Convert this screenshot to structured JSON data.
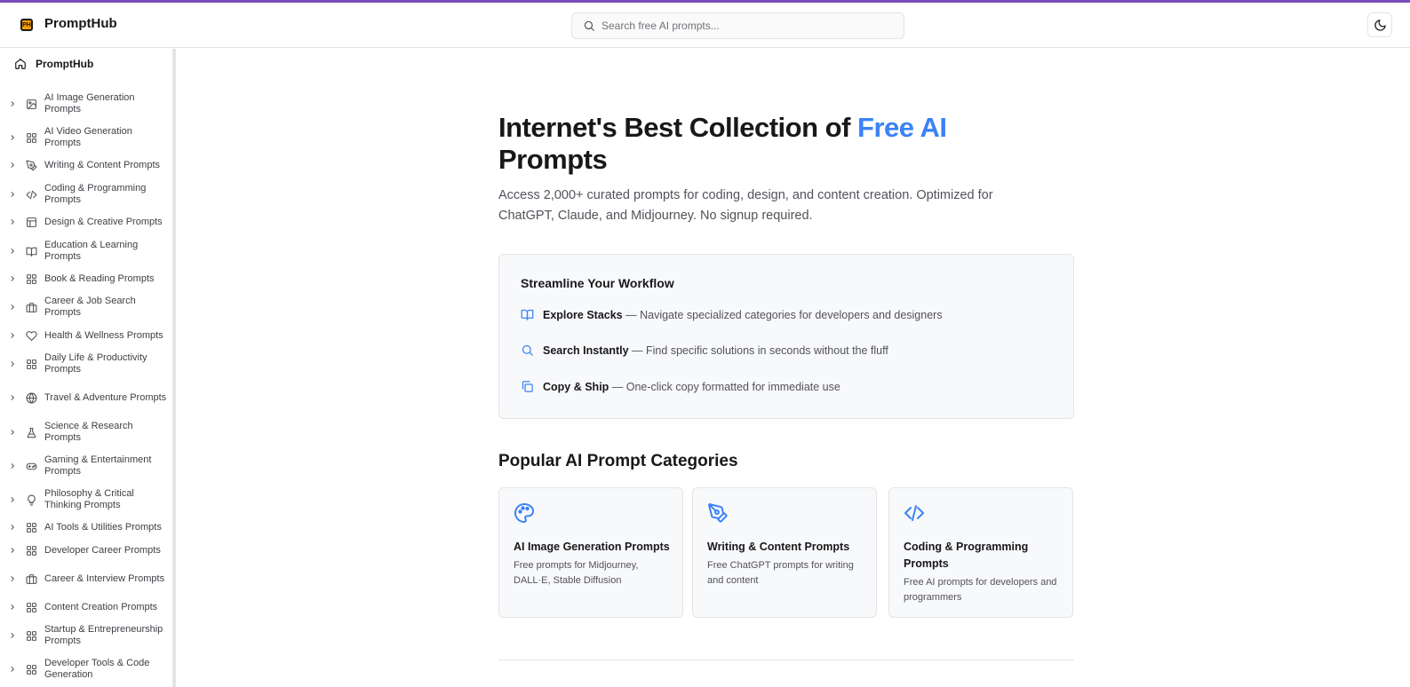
{
  "header": {
    "brand": "PromptHub",
    "logo_text": "PH",
    "search_placeholder": "Search free AI prompts..."
  },
  "sidebar": {
    "home_label": "PromptHub",
    "items": [
      {
        "label": "AI Image Generation Prompts",
        "icon": "image-icon"
      },
      {
        "label": "AI Video Generation Prompts",
        "icon": "grid-icon"
      },
      {
        "label": "Writing & Content Prompts",
        "icon": "pen-icon"
      },
      {
        "label": "Coding & Programming Prompts",
        "icon": "code-icon"
      },
      {
        "label": "Design & Creative Prompts",
        "icon": "layout-icon"
      },
      {
        "label": "Education & Learning Prompts",
        "icon": "book-icon"
      },
      {
        "label": "Book & Reading Prompts",
        "icon": "grid-icon"
      },
      {
        "label": "Career & Job Search Prompts",
        "icon": "briefcase-icon"
      },
      {
        "label": "Health & Wellness Prompts",
        "icon": "heart-icon"
      },
      {
        "label": "Daily Life & Productivity Prompts",
        "icon": "grid-icon"
      },
      {
        "label": "Travel & Adventure Prompts",
        "icon": "globe-icon"
      },
      {
        "label": "Science & Research Prompts",
        "icon": "flask-icon"
      },
      {
        "label": "Gaming & Entertainment Prompts",
        "icon": "gamepad-icon"
      },
      {
        "label": "Philosophy & Critical Thinking Prompts",
        "icon": "lightbulb-icon"
      },
      {
        "label": "AI Tools & Utilities Prompts",
        "icon": "grid-icon"
      },
      {
        "label": "Developer Career Prompts",
        "icon": "grid-icon"
      },
      {
        "label": "Career & Interview Prompts",
        "icon": "briefcase-icon"
      },
      {
        "label": "Content Creation Prompts",
        "icon": "grid-icon"
      },
      {
        "label": "Startup & Entrepreneurship Prompts",
        "icon": "grid-icon"
      },
      {
        "label": "Developer Tools & Code Generation",
        "icon": "grid-icon"
      }
    ]
  },
  "hero": {
    "title_main": "Internet's Best Collection of ",
    "title_accent": "Free AI",
    "title_end": "Prompts",
    "subtitle": "Access 2,000+ curated prompts for coding, design, and content creation. Optimized for ChatGPT, Claude, and Midjourney. No signup required."
  },
  "workflow": {
    "title": "Streamline Your Workflow",
    "items": [
      {
        "bold": "Explore Stacks",
        "text": " — Navigate specialized categories for developers and designers",
        "icon": "book-open-icon"
      },
      {
        "bold": "Search Instantly",
        "text": " — Find specific solutions in seconds without the fluff",
        "icon": "search-icon"
      },
      {
        "bold": "Copy & Ship",
        "text": " — One-click copy formatted for immediate use",
        "icon": "copy-icon"
      }
    ]
  },
  "popular": {
    "title": "Popular AI Prompt Categories",
    "cards": [
      {
        "title": "AI Image Generation Prompts",
        "desc": "Free prompts for Midjourney, DALL·E, Stable Diffusion",
        "icon": "palette-icon"
      },
      {
        "title": "Writing & Content Prompts",
        "desc": "Free ChatGPT prompts for writing and content",
        "icon": "pen-tool-icon"
      },
      {
        "title": "Coding & Programming Prompts",
        "desc": "Free AI prompts for developers and programmers",
        "icon": "code-icon"
      }
    ]
  },
  "colors": {
    "accent": "#3b82f6",
    "top_border": "#7c4dbb",
    "logo": "#f59e0b"
  }
}
